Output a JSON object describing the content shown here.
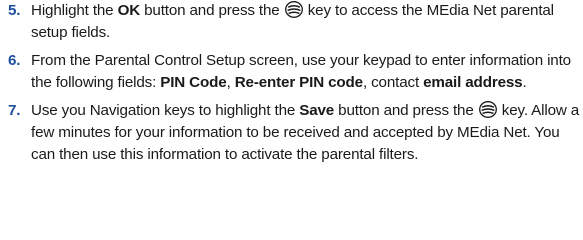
{
  "steps": [
    {
      "number": "5.",
      "t1": "Highlight the ",
      "b1": "OK",
      "t2": " button and press the ",
      "icon": "select-key-icon",
      "t3": " key to access the MEdia Net parental setup fields."
    },
    {
      "number": "6.",
      "t1": "From the Parental Control Setup screen, use your keypad to enter information into the following fields: ",
      "b1": "PIN Code",
      "t2": ", ",
      "b2": "Re-enter PIN code",
      "t3": ", contact ",
      "b3": "email address",
      "t4": "."
    },
    {
      "number": "7.",
      "t1": "Use you Navigation keys to highlight the ",
      "b1": "Save",
      "t2": " button and press the ",
      "icon": "select-key-icon",
      "t3": " key. Allow a few minutes for your information to be received and accepted by MEdia Net. You can then use this information to activate the parental filters."
    }
  ],
  "colors": {
    "step_number": "#1e4f9c",
    "text": "#1a1a1a"
  }
}
